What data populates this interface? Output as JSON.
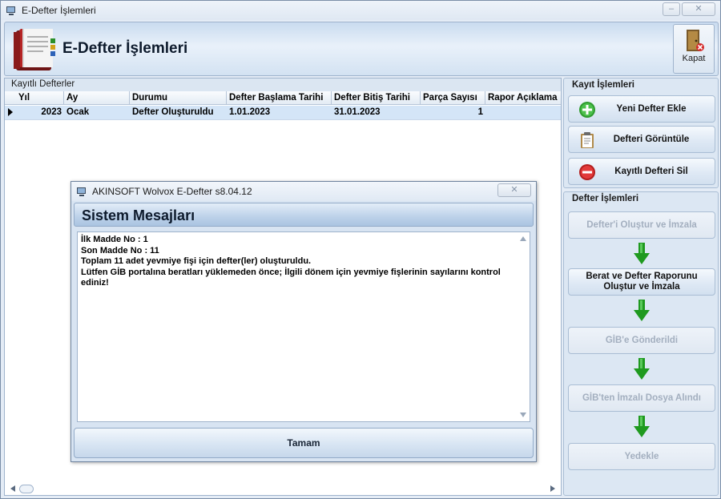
{
  "window": {
    "title": "E-Defter İşlemleri",
    "minimize_icon": "minimize-icon",
    "close_icon": "close-icon"
  },
  "header": {
    "title": "E-Defter İşlemleri",
    "close_button_label": "Kapat"
  },
  "records_panel": {
    "caption": "Kayıtlı Defterler",
    "columns": [
      "Yıl",
      "Ay",
      "Durumu",
      "Defter Başlama Tarihi",
      "Defter Bitiş Tarihi",
      "Parça Sayısı",
      "Rapor Açıklama"
    ],
    "rows": [
      {
        "yil": "2023",
        "ay": "Ocak",
        "durumu": "Defter Oluşturuldu",
        "baslama": "1.01.2023",
        "bitis": "31.01.2023",
        "parca": "1",
        "rapor": ""
      }
    ]
  },
  "record_actions": {
    "caption": "Kayıt İşlemleri",
    "buttons": [
      {
        "label": "Yeni Defter Ekle",
        "icon": "plus-icon"
      },
      {
        "label": "Defteri Görüntüle",
        "icon": "clipboard-icon"
      },
      {
        "label": "Kayıtlı Defteri Sil",
        "icon": "minus-icon"
      }
    ]
  },
  "ledger_actions": {
    "caption": "Defter İşlemleri",
    "buttons": [
      {
        "label": "Defter'i Oluştur ve İmzala",
        "enabled": false
      },
      {
        "label": "Berat ve Defter Raporunu Oluştur ve İmzala",
        "enabled": true
      },
      {
        "label": "GİB'e Gönderildi",
        "enabled": false
      },
      {
        "label": "GİB'ten İmzalı Dosya Alındı",
        "enabled": false
      },
      {
        "label": "Yedekle",
        "enabled": false
      }
    ]
  },
  "dialog": {
    "title": "AKINSOFT Wolvox E-Defter s8.04.12",
    "heading": "Sistem Mesajları",
    "lines": [
      "İlk Madde No : 1",
      "Son Madde No : 11",
      "Toplam 11 adet yevmiye fişi için defter(ler) oluşturuldu.",
      "Lütfen GİB portalına beratları yüklemeden önce; İlgili dönem için yevmiye fişlerinin sayılarını kontrol ediniz!"
    ],
    "ok_label": "Tamam"
  },
  "colors": {
    "accent": "#d4e5f7",
    "disabled_text": "#a3afbf",
    "arrow_green": "#1f9a1f"
  }
}
